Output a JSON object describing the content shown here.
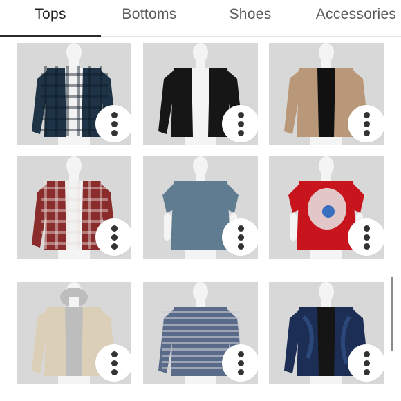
{
  "tabs": [
    {
      "label": "Tops",
      "active": true
    },
    {
      "label": "Bottoms",
      "active": false
    },
    {
      "label": "Shoes",
      "active": false
    },
    {
      "label": "Accessories",
      "active": false
    }
  ],
  "items": [
    {
      "name": "blue plaid flannel shirt",
      "color": "#1e3446",
      "accent": "#0f1c28",
      "inner": "#f2f2f2"
    },
    {
      "name": "black jacket",
      "color": "#161616",
      "accent": "#2a2a2a",
      "inner": "#f4f4f4"
    },
    {
      "name": "tan shirt jacket",
      "color": "#b89878",
      "accent": "#a07f60",
      "inner": "#111111"
    },
    {
      "name": "red plaid flannel shirt",
      "color": "#8a2c2c",
      "accent": "#e8e0dc",
      "inner": "#f2f2f2"
    },
    {
      "name": "blue polo shirt",
      "color": "#5f7c90",
      "accent": "#4e697b",
      "inner": "#5f7c90"
    },
    {
      "name": "red graphic t-shirt",
      "color": "#c8141c",
      "accent": "#e6e6e6",
      "inner": "#c8141c"
    },
    {
      "name": "beige hooded jacket",
      "color": "#dccfb8",
      "accent": "#c9b99f",
      "inner": "#bdbdbd"
    },
    {
      "name": "striped knit sweater",
      "color": "#5a6b8a",
      "accent": "#c9c9d3",
      "inner": "#5a6b8a"
    },
    {
      "name": "navy leather jacket",
      "color": "#1d2e55",
      "accent": "#33528a",
      "inner": "#151515"
    }
  ]
}
